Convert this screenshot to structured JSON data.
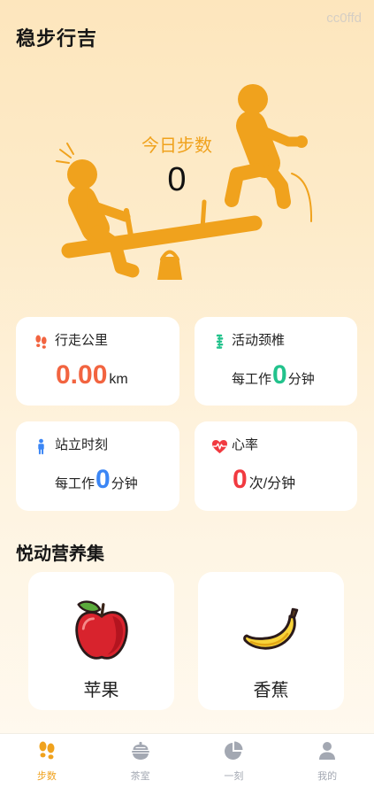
{
  "header": {
    "title": "稳步行吉",
    "watermark": "cc0ffd"
  },
  "hero": {
    "label": "今日步数",
    "steps": "0",
    "accent_color": "#f0a21d"
  },
  "stats": {
    "walk": {
      "label": "行走公里",
      "value": "0.00",
      "unit": "km",
      "icon": "footprints-icon",
      "color": "#f26440"
    },
    "neck": {
      "label": "活动颈椎",
      "prefix": "每工作",
      "value": "0",
      "unit": "分钟",
      "icon": "spine-icon",
      "color": "#22c28c"
    },
    "stand": {
      "label": "站立时刻",
      "prefix": "每工作",
      "value": "0",
      "unit": "分钟",
      "icon": "standing-person-icon",
      "color": "#3b86f5"
    },
    "heart": {
      "label": "心率",
      "value": "0",
      "unit": "次/分钟",
      "icon": "heart-pulse-icon",
      "color": "#f13a40"
    }
  },
  "nutrition": {
    "title": "悦动营养集",
    "items": [
      {
        "name": "苹果",
        "icon": "apple-icon"
      },
      {
        "name": "香蕉",
        "icon": "banana-icon"
      }
    ]
  },
  "tabbar": {
    "items": [
      {
        "label": "步数",
        "icon": "footprints-icon",
        "active": true,
        "color": "#f0a21d"
      },
      {
        "label": "茶室",
        "icon": "tea-bowl-icon",
        "active": false,
        "color": "#a3a8b2"
      },
      {
        "label": "一刻",
        "icon": "pie-chart-icon",
        "active": false,
        "color": "#a3a8b2"
      },
      {
        "label": "我的",
        "icon": "person-icon",
        "active": false,
        "color": "#a3a8b2"
      }
    ]
  }
}
